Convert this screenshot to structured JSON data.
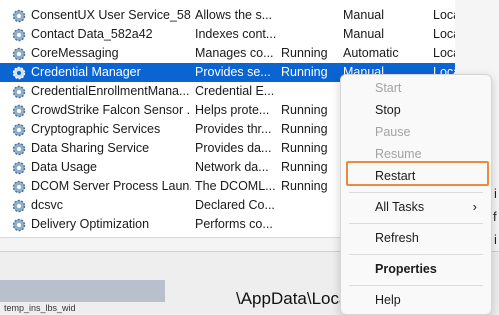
{
  "services": [
    {
      "name": "ConsentUX User Service_58...",
      "description": "Allows the s...",
      "status": "",
      "startup": "Manual",
      "logon": "Loca"
    },
    {
      "name": "Contact Data_582a42",
      "description": "Indexes cont...",
      "status": "",
      "startup": "Manual",
      "logon": "Loca"
    },
    {
      "name": "CoreMessaging",
      "description": "Manages co...",
      "status": "Running",
      "startup": "Automatic",
      "logon": "Loca"
    },
    {
      "name": "Credential Manager",
      "description": "Provides se...",
      "status": "Running",
      "startup": "Manual",
      "logon": "Loca"
    },
    {
      "name": "CredentialEnrollmentMana...",
      "description": "Credential E...",
      "status": "",
      "startup": "",
      "logon": ""
    },
    {
      "name": "CrowdStrike Falcon Sensor ...",
      "description": "Helps prote...",
      "status": "Running",
      "startup": "",
      "logon": ""
    },
    {
      "name": "Cryptographic Services",
      "description": "Provides thr...",
      "status": "Running",
      "startup": "",
      "logon": ""
    },
    {
      "name": "Data Sharing Service",
      "description": "Provides da...",
      "status": "Running",
      "startup": "",
      "logon": ""
    },
    {
      "name": "Data Usage",
      "description": "Network da...",
      "status": "Running",
      "startup": "",
      "logon": ""
    },
    {
      "name": "DCOM Server Process Laun...",
      "description": "The DCOML...",
      "status": "Running",
      "startup": "",
      "logon": ""
    },
    {
      "name": "dcsvc",
      "description": "Declared Co...",
      "status": "",
      "startup": "",
      "logon": ""
    },
    {
      "name": "Delivery Optimization",
      "description": "Performs co...",
      "status": "",
      "startup": "",
      "logon": ""
    }
  ],
  "context_menu": {
    "start": "Start",
    "stop": "Stop",
    "pause": "Pause",
    "resume": "Resume",
    "restart": "Restart",
    "all_tasks": "All Tasks",
    "all_tasks_arrow": "›",
    "refresh": "Refresh",
    "properties": "Properties",
    "help": "Help"
  },
  "background": {
    "path_fragment": "\\AppData\\Local",
    "thumbnail_label": "temp_ins_lbs_wid",
    "right_frag_1": "i",
    "right_frag_2": "f",
    "right_frag_3": "i"
  },
  "colors": {
    "selection": "#0a64d2",
    "highlight_box": "#ee8a3c"
  }
}
